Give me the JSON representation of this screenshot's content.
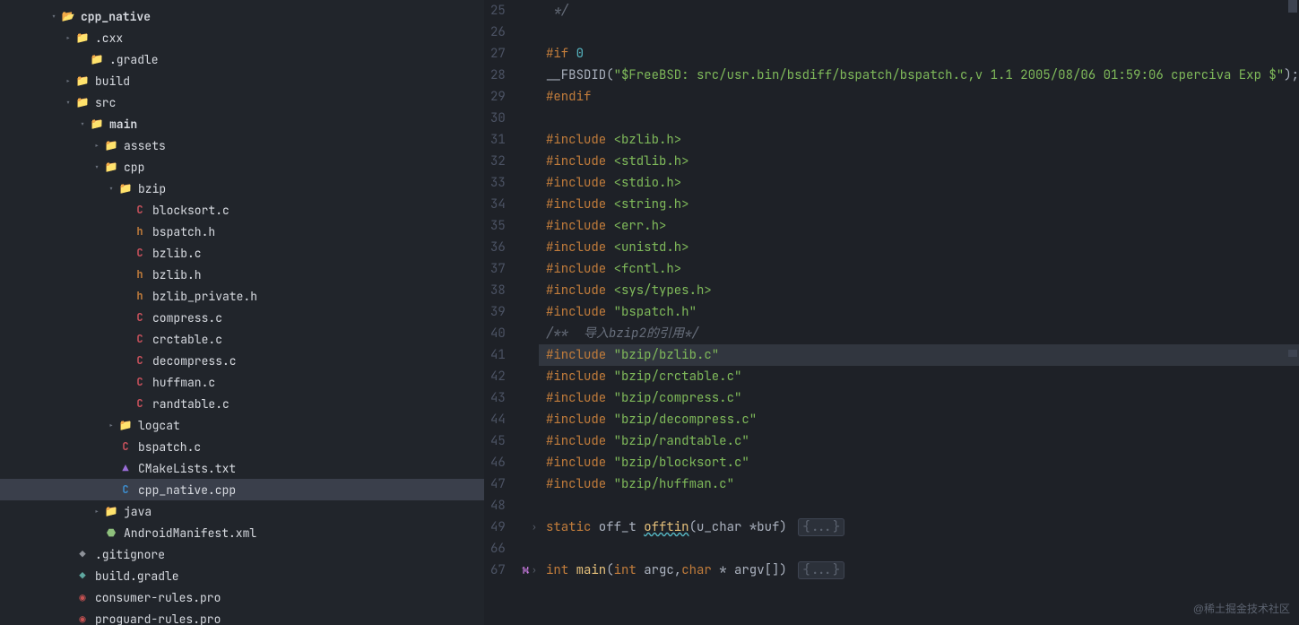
{
  "tree": [
    {
      "d": 2,
      "ch": "down",
      "icon": "folder-open",
      "label": "cpp_native",
      "bold": true
    },
    {
      "d": 3,
      "ch": "right",
      "icon": "folder",
      "label": ".cxx"
    },
    {
      "d": 4,
      "ch": "",
      "icon": "folder-blue",
      "label": ".gradle"
    },
    {
      "d": 3,
      "ch": "right",
      "icon": "folder-red",
      "label": "build"
    },
    {
      "d": 3,
      "ch": "down",
      "icon": "folder-blue",
      "label": "src"
    },
    {
      "d": 4,
      "ch": "down",
      "icon": "folder-green",
      "label": "main",
      "bold": true
    },
    {
      "d": 5,
      "ch": "right",
      "icon": "folder-purple",
      "label": "assets"
    },
    {
      "d": 5,
      "ch": "down",
      "icon": "folder-blue",
      "label": "cpp"
    },
    {
      "d": 6,
      "ch": "down",
      "icon": "folder",
      "label": "bzip"
    },
    {
      "d": 7,
      "ch": "",
      "icon": "c",
      "label": "blocksort.c"
    },
    {
      "d": 7,
      "ch": "",
      "icon": "h",
      "label": "bspatch.h"
    },
    {
      "d": 7,
      "ch": "",
      "icon": "c",
      "label": "bzlib.c"
    },
    {
      "d": 7,
      "ch": "",
      "icon": "h",
      "label": "bzlib.h"
    },
    {
      "d": 7,
      "ch": "",
      "icon": "h",
      "label": "bzlib_private.h"
    },
    {
      "d": 7,
      "ch": "",
      "icon": "c",
      "label": "compress.c"
    },
    {
      "d": 7,
      "ch": "",
      "icon": "c",
      "label": "crctable.c"
    },
    {
      "d": 7,
      "ch": "",
      "icon": "c",
      "label": "decompress.c"
    },
    {
      "d": 7,
      "ch": "",
      "icon": "c",
      "label": "huffman.c"
    },
    {
      "d": 7,
      "ch": "",
      "icon": "c",
      "label": "randtable.c"
    },
    {
      "d": 6,
      "ch": "right",
      "icon": "folder",
      "label": "logcat"
    },
    {
      "d": 6,
      "ch": "",
      "icon": "c",
      "label": "bspatch.c"
    },
    {
      "d": 6,
      "ch": "",
      "icon": "txt",
      "label": "CMakeLists.txt"
    },
    {
      "d": 6,
      "ch": "",
      "icon": "cpp",
      "label": "cpp_native.cpp",
      "selected": true
    },
    {
      "d": 5,
      "ch": "right",
      "icon": "folder-purple",
      "label": "java"
    },
    {
      "d": 5,
      "ch": "",
      "icon": "xml",
      "label": "AndroidManifest.xml"
    },
    {
      "d": 3,
      "ch": "",
      "icon": "git",
      "label": ".gitignore"
    },
    {
      "d": 3,
      "ch": "",
      "icon": "gradle",
      "label": "build.gradle"
    },
    {
      "d": 3,
      "ch": "",
      "icon": "pro",
      "label": "consumer-rules.pro"
    },
    {
      "d": 3,
      "ch": "",
      "icon": "pro",
      "label": "proguard-rules.pro"
    }
  ],
  "lines": [
    {
      "n": 25,
      "seg": [
        {
          "t": " */",
          "c": "comment"
        }
      ]
    },
    {
      "n": 26,
      "seg": []
    },
    {
      "n": 27,
      "seg": [
        {
          "t": "#if ",
          "c": "pre"
        },
        {
          "t": "0",
          "c": "num"
        }
      ]
    },
    {
      "n": 28,
      "seg": [
        {
          "t": "__FBSDID(",
          "c": "plain"
        },
        {
          "t": "\"$FreeBSD: src/usr.bin/bsdiff/bspatch/bspatch.c,v 1.1 2005/08/06 01:59:06 cperciva Exp $\"",
          "c": "str"
        },
        {
          "t": ");",
          "c": "plain"
        }
      ]
    },
    {
      "n": 29,
      "seg": [
        {
          "t": "#endif",
          "c": "pre"
        }
      ]
    },
    {
      "n": 30,
      "seg": []
    },
    {
      "n": 31,
      "seg": [
        {
          "t": "#include ",
          "c": "pre"
        },
        {
          "t": "<bzlib.h>",
          "c": "ang"
        }
      ]
    },
    {
      "n": 32,
      "seg": [
        {
          "t": "#include ",
          "c": "pre"
        },
        {
          "t": "<stdlib.h>",
          "c": "ang"
        }
      ]
    },
    {
      "n": 33,
      "seg": [
        {
          "t": "#include ",
          "c": "pre"
        },
        {
          "t": "<stdio.h>",
          "c": "ang"
        }
      ]
    },
    {
      "n": 34,
      "seg": [
        {
          "t": "#include ",
          "c": "pre"
        },
        {
          "t": "<string.h>",
          "c": "ang"
        }
      ]
    },
    {
      "n": 35,
      "seg": [
        {
          "t": "#include ",
          "c": "pre"
        },
        {
          "t": "<err.h>",
          "c": "ang"
        }
      ]
    },
    {
      "n": 36,
      "seg": [
        {
          "t": "#include ",
          "c": "pre"
        },
        {
          "t": "<unistd.h>",
          "c": "ang"
        }
      ]
    },
    {
      "n": 37,
      "seg": [
        {
          "t": "#include ",
          "c": "pre"
        },
        {
          "t": "<fcntl.h>",
          "c": "ang"
        }
      ]
    },
    {
      "n": 38,
      "seg": [
        {
          "t": "#include ",
          "c": "pre"
        },
        {
          "t": "<sys/types.h>",
          "c": "ang"
        }
      ]
    },
    {
      "n": 39,
      "seg": [
        {
          "t": "#include ",
          "c": "pre"
        },
        {
          "t": "\"bspatch.h\"",
          "c": "str"
        }
      ]
    },
    {
      "n": 40,
      "seg": [
        {
          "t": "/**  导入bzip2的引用*/",
          "c": "comment"
        }
      ]
    },
    {
      "n": 41,
      "hl": true,
      "seg": [
        {
          "t": "#include ",
          "c": "pre"
        },
        {
          "t": "\"bzip/bzlib.c\"",
          "c": "str"
        }
      ]
    },
    {
      "n": 42,
      "seg": [
        {
          "t": "#include ",
          "c": "pre"
        },
        {
          "t": "\"bzip/crctable.c\"",
          "c": "str"
        }
      ]
    },
    {
      "n": 43,
      "seg": [
        {
          "t": "#include ",
          "c": "pre"
        },
        {
          "t": "\"bzip/compress.c\"",
          "c": "str"
        }
      ]
    },
    {
      "n": 44,
      "seg": [
        {
          "t": "#include ",
          "c": "pre"
        },
        {
          "t": "\"bzip/decompress.c\"",
          "c": "str"
        }
      ]
    },
    {
      "n": 45,
      "seg": [
        {
          "t": "#include ",
          "c": "pre"
        },
        {
          "t": "\"bzip/randtable.c\"",
          "c": "str"
        }
      ]
    },
    {
      "n": 46,
      "seg": [
        {
          "t": "#include ",
          "c": "pre"
        },
        {
          "t": "\"bzip/blocksort.c\"",
          "c": "str"
        }
      ]
    },
    {
      "n": 47,
      "seg": [
        {
          "t": "#include ",
          "c": "pre"
        },
        {
          "t": "\"bzip/huffman.c\"",
          "c": "str"
        }
      ]
    },
    {
      "n": 48,
      "seg": []
    },
    {
      "n": 49,
      "fold": ">",
      "seg": [
        {
          "t": "static ",
          "c": "kw2"
        },
        {
          "t": "off_t ",
          "c": "plain"
        },
        {
          "t": "offtin",
          "c": "fn-u"
        },
        {
          "t": "(",
          "c": "plain"
        },
        {
          "t": "u_char ",
          "c": "plain"
        },
        {
          "t": "*buf) ",
          "c": "plain"
        }
      ],
      "folded": "{...}"
    },
    {
      "n": 66,
      "seg": []
    },
    {
      "n": 67,
      "fold": ">",
      "bp": true,
      "seg": [
        {
          "t": "int ",
          "c": "kw2"
        },
        {
          "t": "main",
          "c": "fn"
        },
        {
          "t": "(",
          "c": "plain"
        },
        {
          "t": "int ",
          "c": "kw2"
        },
        {
          "t": "argc,",
          "c": "plain"
        },
        {
          "t": "char ",
          "c": "kw2"
        },
        {
          "t": "* argv[]) ",
          "c": "plain"
        }
      ],
      "folded": "{...}"
    }
  ],
  "watermark": "@稀土掘金技术社区"
}
